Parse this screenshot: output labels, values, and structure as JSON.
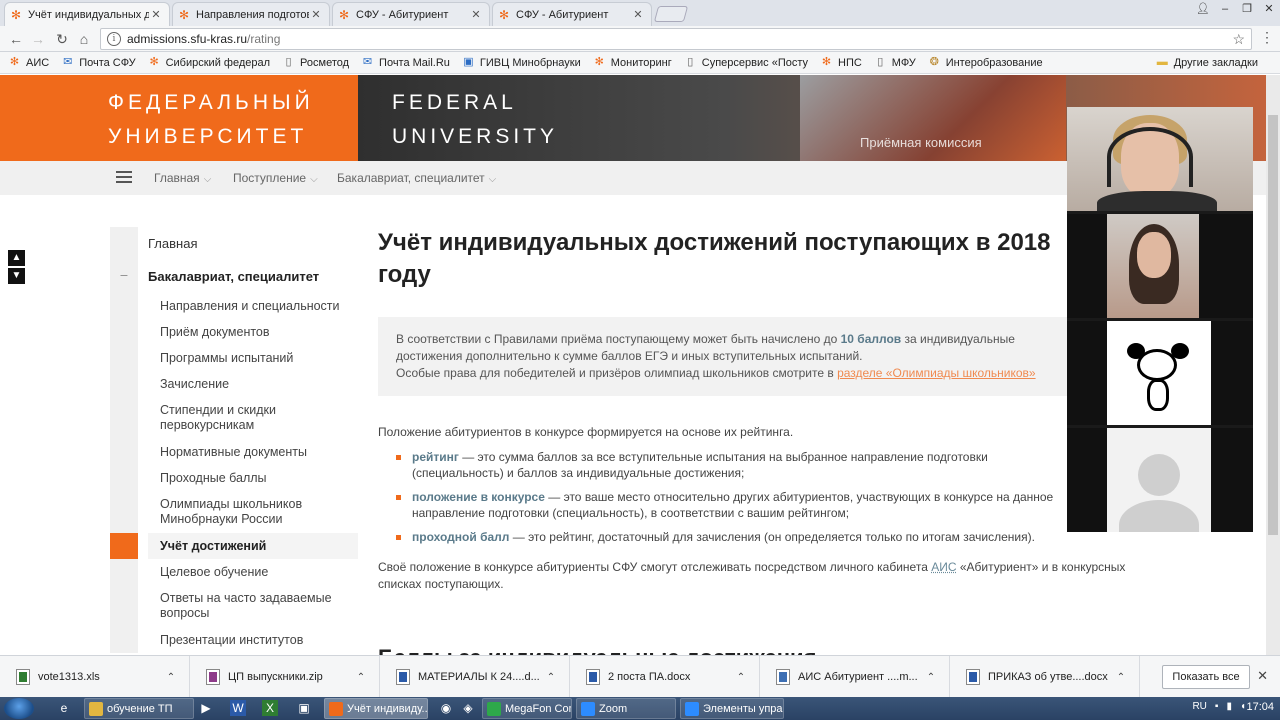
{
  "browser": {
    "tabs": [
      {
        "title": "Учёт индивидуальных д",
        "active": true
      },
      {
        "title": "Направления подготов",
        "active": false
      },
      {
        "title": "СФУ - Абитуриент",
        "active": false
      },
      {
        "title": "СФУ - Абитуриент",
        "active": false
      }
    ],
    "url_host": "admissions.sfu-kras.ru",
    "url_path": "/rating",
    "bookmarks": [
      "АИС",
      "Почта СФУ",
      "Сибирский федерал",
      "Росметод",
      "Почта Mail.Ru",
      "ГИВЦ Минобрнауки",
      "Мониторинг",
      "Суперсервис «Посту",
      "НПС",
      "МФУ",
      "Интеробразование"
    ],
    "other_bookmarks": "Другие закладки"
  },
  "site": {
    "hero_ru_1": "ФЕДЕРАЛЬНЫЙ",
    "hero_ru_2": "УНИВЕРСИТЕТ",
    "hero_en_1": "FEDERAL",
    "hero_en_2": "UNIVERSITY",
    "hero_photo_label": "Приёмная комиссия",
    "breadcrumbs": [
      "Главная",
      "Поступление",
      "Бакалавриат, специалитет"
    ]
  },
  "sidebar": {
    "items": [
      {
        "label": "Главная",
        "kind": "top"
      },
      {
        "label": "Бакалавриат, специалитет",
        "kind": "bold",
        "mark": "–"
      },
      {
        "label": "Направления и специальности",
        "kind": "sub"
      },
      {
        "label": "Приём документов",
        "kind": "sub"
      },
      {
        "label": "Программы испытаний",
        "kind": "sub"
      },
      {
        "label": "Зачисление",
        "kind": "sub"
      },
      {
        "label": "Стипендии и скидки первокурсникам",
        "kind": "sub"
      },
      {
        "label": "Нормативные документы",
        "kind": "sub"
      },
      {
        "label": "Проходные баллы",
        "kind": "sub"
      },
      {
        "label": "Олимпиады школьников Минобрнауки России",
        "kind": "sub"
      },
      {
        "label": "Учёт достижений",
        "kind": "sel"
      },
      {
        "label": "Целевое обучение",
        "kind": "sub"
      },
      {
        "label": "Ответы на часто задаваемые вопросы",
        "kind": "sub"
      },
      {
        "label": "Презентации институтов",
        "kind": "sub"
      }
    ]
  },
  "main": {
    "title": "Учёт индивидуальных достижений поступающих в 2018 году",
    "note_before_bold": "В соответствии с Правилами приёма поступающему может быть начислено до ",
    "note_bold": "10 баллов",
    "note_after_bold": " за индивидуальные достижения дополнительно к сумме баллов ЕГЭ и иных вступительных испытаний.",
    "note_line2": "Особые права для победителей и призёров олимпиад школьников смотрите в ",
    "note_link": "разделе «Олимпиады школьников»",
    "intro": "Положение абитуриентов в конкурсе формируется на основе их рейтинга.",
    "bullets": [
      {
        "term": "рейтинг",
        "text": " — это сумма баллов за все вступительные испытания на выбранное направление подготовки (специальность) и баллов за индивидуальные достижения;"
      },
      {
        "term": "положение в конкурсе",
        "text": " — это ваше место относительно других абитуриентов, участвующих в конкурсе на данное направление подготовки (специальность), в соответствии с вашим рейтингом;"
      },
      {
        "term": "проходной балл",
        "text": " — это рейтинг, достаточный для зачисления (он определяется только по итогам зачисления)."
      }
    ],
    "outro_before": "Своё положение в конкурсе абитуриенты СФУ смогут отслеживать посредством личного кабинета ",
    "outro_abbr": "АИС",
    "outro_after": " «Абитуриент» и в конкурсных списках поступающих.",
    "next_heading": "Баллы за индивидуальные достижения"
  },
  "downloads": [
    {
      "name": "vote1313.xls",
      "kind": "xls"
    },
    {
      "name": "ЦП выпускники.zip",
      "kind": "zip"
    },
    {
      "name": "МАТЕРИАЛЫ К 24....d...",
      "kind": "doc"
    },
    {
      "name": "2 поста ПА.docx",
      "kind": "doc"
    },
    {
      "name": "АИС Абитуриент ....m...",
      "kind": "htm"
    },
    {
      "name": "ПРИКАЗ об утве....docx",
      "kind": "doc"
    }
  ],
  "show_all": "Показать все",
  "taskbar": {
    "items": [
      {
        "label": "обучение ТП",
        "color": "#e2b640"
      },
      {
        "label": "Учёт индивиду...",
        "color": "#f06a1b",
        "active": true
      },
      {
        "label": "MegaFon Com...",
        "color": "#2ea84a"
      },
      {
        "label": "Zoom",
        "color": "#2d8cff"
      },
      {
        "label": "Элементы упра...",
        "color": "#2d8cff"
      }
    ],
    "lang": "RU",
    "time": "17:04"
  },
  "colors": {
    "accent": "#f06a1b",
    "link": "#5a7a8a"
  }
}
